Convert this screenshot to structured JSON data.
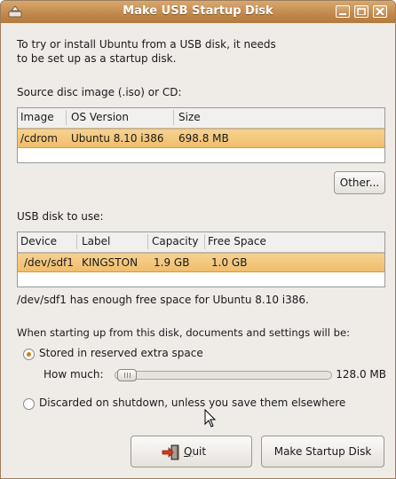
{
  "window": {
    "title": "Make USB Startup Disk",
    "controls": [
      "minimize",
      "maximize",
      "close"
    ]
  },
  "intro": {
    "line1": "To try or install Ubuntu from a USB disk, it needs",
    "line2": "to be set up as a startup disk."
  },
  "source": {
    "label": "Source disc image (.iso) or CD:",
    "columns": [
      "Image",
      "OS Version",
      "Size"
    ],
    "rows": [
      {
        "image": "/cdrom",
        "os_version": "Ubuntu 8.10 i386",
        "size": "698.8 MB",
        "selected": true
      }
    ],
    "other_button": "Other..."
  },
  "usb": {
    "label": "USB disk to use:",
    "columns": [
      "Device",
      "Label",
      "Capacity",
      "Free Space"
    ],
    "rows": [
      {
        "device": "/dev/sdf1",
        "label": "KINGSTON",
        "capacity": "1.9 GB",
        "free_space": "1.0 GB",
        "selected": true
      }
    ],
    "status": "/dev/sdf1 has enough free space for Ubuntu 8.10 i386."
  },
  "options": {
    "heading": "When starting up from this disk, documents and settings will be:",
    "stored": {
      "label": "Stored in reserved extra space",
      "selected": true
    },
    "how_much_label": "How much:",
    "how_much_value": "128.0 MB",
    "slider_fraction": 0.0,
    "discarded": {
      "label": "Discarded on shutdown, unless you save them elsewhere",
      "selected": false
    }
  },
  "buttons": {
    "quit_mnemonic": "Q",
    "quit_rest": "uit",
    "make": "Make Startup Disk"
  },
  "icons": {
    "app": "usb-creator-icon",
    "quit": "exit-icon",
    "cursor": "mouse-pointer-icon"
  },
  "colors": {
    "titlebar": "#c38a4c",
    "selection": "#f1bd6b",
    "radio_active": "#d87d16",
    "window_bg": "#efebe7"
  }
}
